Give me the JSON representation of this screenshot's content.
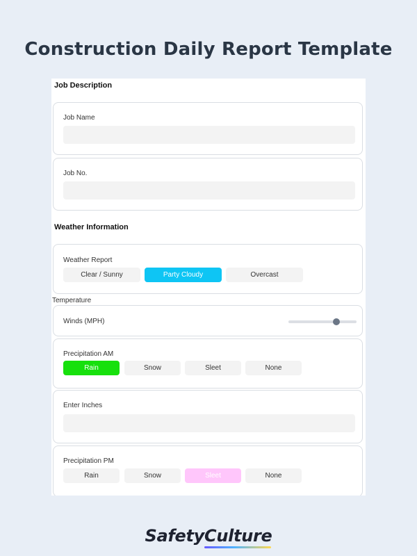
{
  "page": {
    "title": "Construction Daily Report Template"
  },
  "sections": {
    "job": {
      "heading": "Job Description",
      "job_name": {
        "label": "Job Name",
        "value": "",
        "placeholder": ""
      },
      "job_no": {
        "label": "Job No.",
        "value": "",
        "placeholder": ""
      }
    },
    "weather": {
      "heading": "Weather Information",
      "weather_report": {
        "label": "Weather Report",
        "options": [
          "Clear / Sunny",
          "Party Cloudy",
          "Overcast"
        ],
        "selected": "Party Cloudy",
        "selected_color": "#0ec5f4"
      },
      "temperature_label": "Temperature",
      "winds": {
        "label": "Winds (MPH)",
        "slider_fraction": 0.7
      },
      "precip_am": {
        "label": "Precipitation AM",
        "options": [
          "Rain",
          "Snow",
          "Sleet",
          "None"
        ],
        "selected": "Rain",
        "selected_color": "#17e00d"
      },
      "enter_inches": {
        "label": "Enter Inches",
        "value": "",
        "placeholder": ""
      },
      "precip_pm": {
        "label": "Precipitation PM",
        "options": [
          "Rain",
          "Snow",
          "Sleet",
          "None"
        ],
        "selected": "Sleet",
        "selected_color": "#ffc6fb"
      }
    }
  },
  "brand": {
    "logo": "SafetyCulture"
  }
}
